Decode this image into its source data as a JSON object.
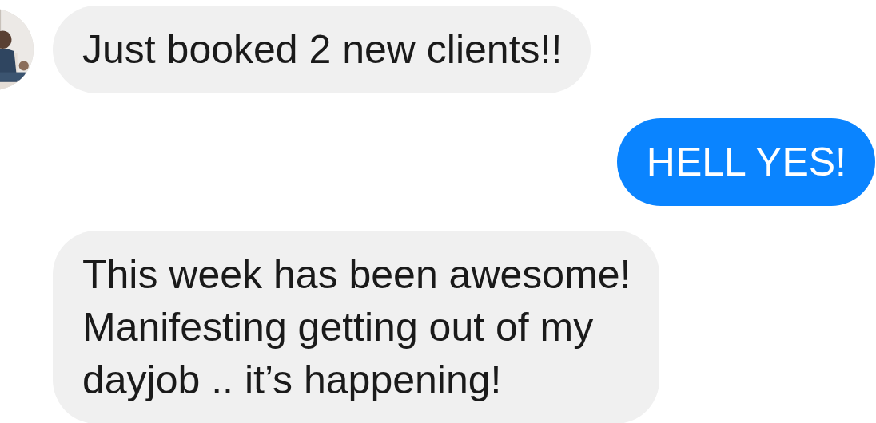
{
  "messages": [
    {
      "kind": "incoming",
      "avatar": true,
      "text": "Just booked 2 new clients!!"
    },
    {
      "kind": "outgoing",
      "avatar": false,
      "text": "HELL YES!"
    },
    {
      "kind": "incoming",
      "avatar": false,
      "text": "This week has been awesome!\nManifesting getting out of my\ndayjob .. it’s happening!"
    }
  ]
}
